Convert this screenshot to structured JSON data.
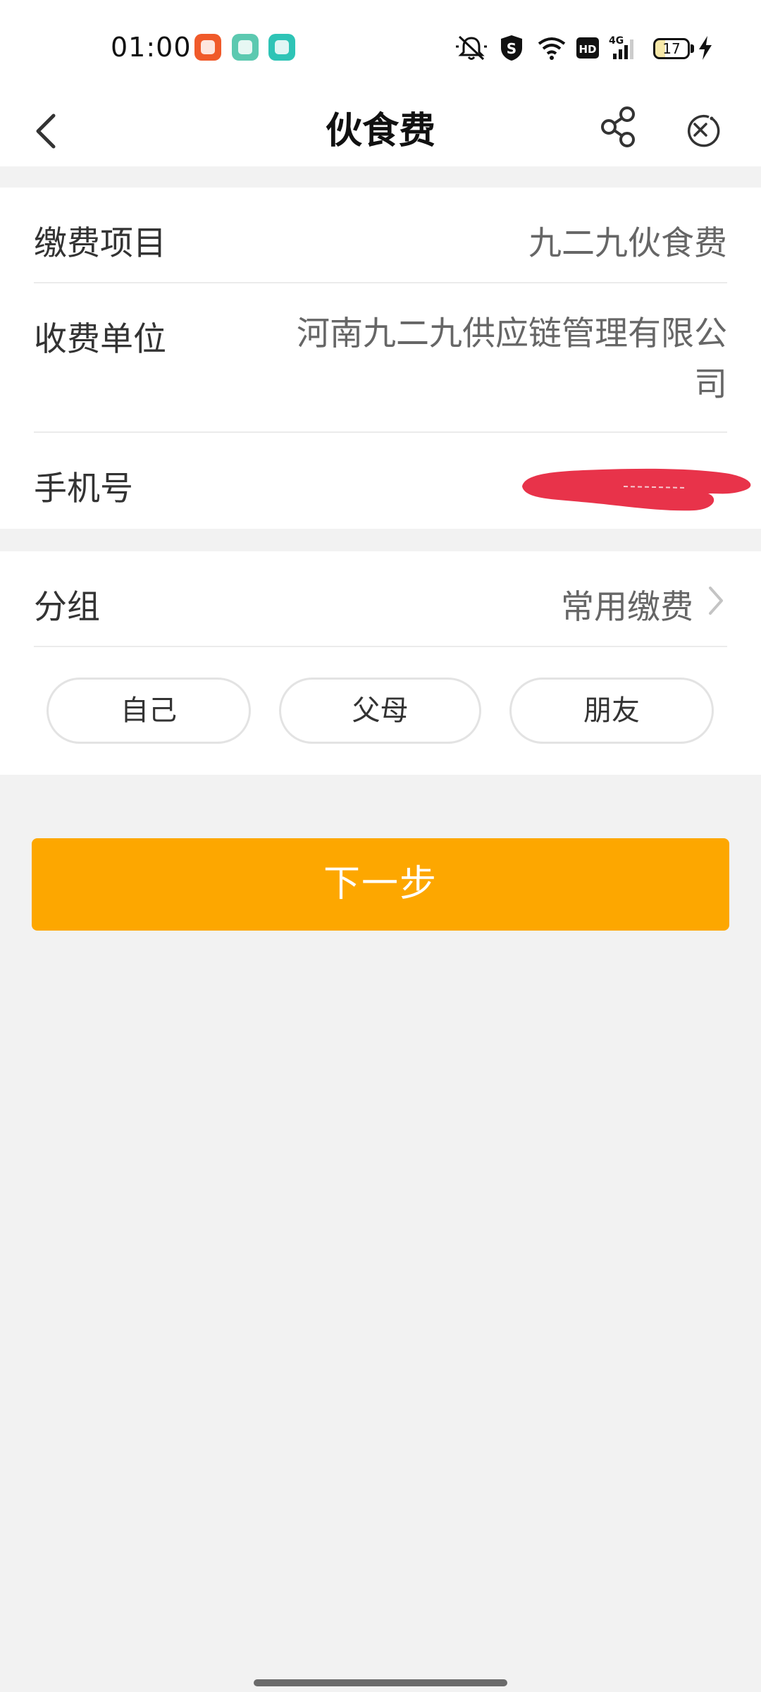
{
  "status_bar": {
    "time": "01:00",
    "battery_level": "17",
    "network_label": "4G",
    "hd_label": "HD"
  },
  "header": {
    "title": "伙食费"
  },
  "form": {
    "project": {
      "label": "缴费项目",
      "value": "九二九伙食费"
    },
    "payee": {
      "label": "收费单位",
      "value": "河南九二九供应链管理有限公司"
    },
    "phone": {
      "label": "手机号",
      "value": ""
    }
  },
  "group": {
    "label": "分组",
    "value": "常用缴费",
    "chips": [
      "自己",
      "父母",
      "朋友"
    ]
  },
  "actions": {
    "next_label": "下一步"
  },
  "colors": {
    "primary": "#fda700",
    "background": "#f2f2f2",
    "redaction": "#e8334a"
  }
}
